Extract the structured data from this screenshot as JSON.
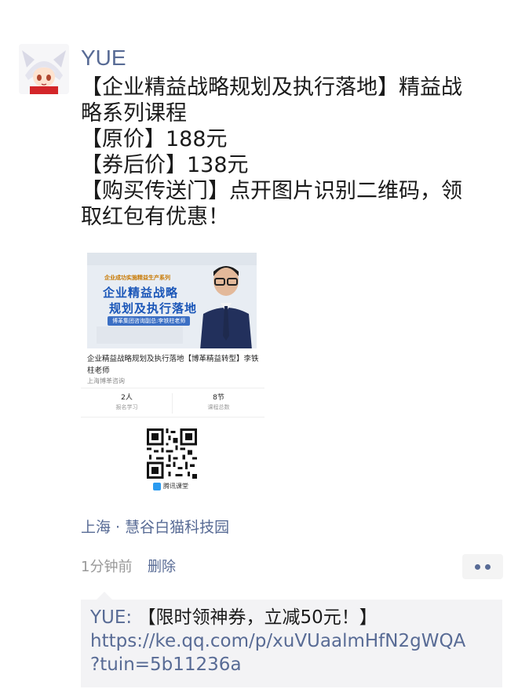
{
  "post": {
    "username": "YUE",
    "text_lines": [
      "【企业精益战略规划及执行落地】精益战",
      "略系列课程",
      "【原价】188元",
      "【券后价】138元",
      "【购买传送门】点开图片识别二维码，领",
      "取红包有优惠！"
    ],
    "location": "上海 · 慧谷白猫科技园",
    "time": "1分钟前",
    "delete_label": "删除"
  },
  "shared_image": {
    "banner_series": "企业成功实施精益生产系列",
    "banner_title_1": "企业精益战略",
    "banner_title_2": "规划及执行落地",
    "banner_subtitle": "博革集团咨询副总:李铁柱老师",
    "course_title": "企业精益战略规划及执行落地【博革精益转型】李铁柱老师",
    "course_org": "上海博革咨询",
    "stat_1_value": "2人",
    "stat_1_label": "报名学习",
    "stat_2_value": "8节",
    "stat_2_label": "课程总数",
    "qr_brand": "腾讯课堂"
  },
  "comment": {
    "author": "YUE:",
    "text": " 【限时领神券，立减50元！】",
    "link_line_1": "https://ke.qq.com/p/xuVUaalmHfN2gWQA",
    "link_line_2": "?tuin=5b11236a"
  },
  "colors": {
    "link": "#586b95",
    "accent": "#1a56b8"
  },
  "icons": {
    "avatar": "anime-avatar-icon",
    "more": "more-dots-icon",
    "qr": "qr-code-icon",
    "brand": "tencent-classroom-icon"
  }
}
